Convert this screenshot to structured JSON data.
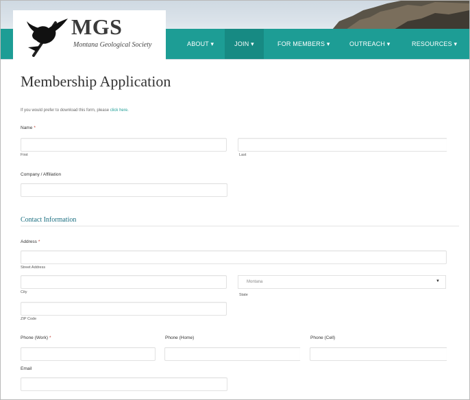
{
  "header": {
    "logo": {
      "title": "MGS",
      "subtitle": "Montana Geological Society"
    },
    "nav": [
      {
        "label": "ABOUT ▾"
      },
      {
        "label": "JOIN ▾"
      },
      {
        "label": "FOR MEMBERS ▾"
      },
      {
        "label": "OUTREACH ▾"
      },
      {
        "label": "RESOURCES ▾"
      }
    ],
    "colors": {
      "nav_bg": "#1d9d95",
      "nav_active": "#178a83"
    }
  },
  "page": {
    "title": "Membership Application",
    "intro_text": "If you would prefer to download this form, please",
    "intro_link": "click here."
  },
  "form": {
    "name": {
      "label": "Name",
      "required_mark": "*",
      "first_sub": "First",
      "last_sub": "Last"
    },
    "company": {
      "label": "Company / Affiliation"
    },
    "contact_section": "Contact Information",
    "address": {
      "label": "Address",
      "required_mark": "*",
      "street_sub": "Street Address",
      "city_sub": "City",
      "state_sub": "State",
      "state_value": "Montana",
      "zip_sub": "ZIP Code"
    },
    "phone_work": {
      "label": "Phone (Work)",
      "required_mark": "*"
    },
    "phone_home": {
      "label": "Phone (Home)"
    },
    "phone_cell": {
      "label": "Phone (Cell)"
    },
    "email": {
      "label": "Email"
    }
  }
}
